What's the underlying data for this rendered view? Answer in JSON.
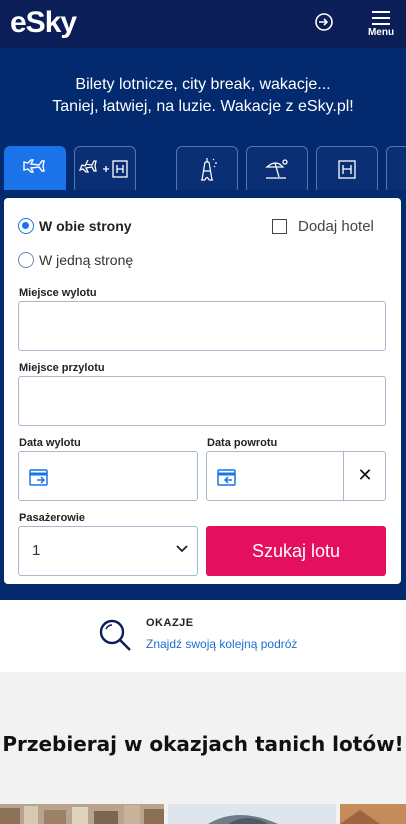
{
  "header": {
    "logo": "eSky",
    "login_icon": "login-arrow-icon",
    "menu_label": "Menu",
    "menu_icon": "hamburger-icon"
  },
  "hero": {
    "tagline_line1": "Bilety lotnicze, city break, wakacje...",
    "tagline_line2": "Taniej, łatwiej, na luzie. Wakacje z eSky.pl!"
  },
  "tabs": [
    {
      "icon": "plane-icon",
      "active": true
    },
    {
      "icon": "plane-plus-hotel-icon",
      "active": false
    },
    {
      "icon": "eiffel-tower-icon",
      "active": false
    },
    {
      "icon": "beach-icon",
      "active": false
    },
    {
      "icon": "hotel-icon",
      "active": false
    }
  ],
  "form": {
    "trip_round": "W obie strony",
    "trip_oneway": "W jedną stronę",
    "add_hotel": "Dodaj hotel",
    "origin_label": "Miejsce wylotu",
    "origin_value": "",
    "destination_label": "Miejsce przylotu",
    "destination_value": "",
    "depart_label": "Data wylotu",
    "depart_value": "",
    "return_label": "Data powrotu",
    "return_value": "",
    "clear_label": "✕",
    "passengers_label": "Pasażerowie",
    "passengers_value": "1",
    "search_label": "Szukaj lotu"
  },
  "deals": {
    "title": "OKAZJE",
    "link": "Znajdź swoją kolejną podróż"
  },
  "section": {
    "heading": "Przebieraj w okazjach tanich lotów!"
  },
  "colors": {
    "header_bg": "#0b1e57",
    "hero_bg": "#03296f",
    "accent": "#1a73e8",
    "search_button": "#e4105f"
  }
}
